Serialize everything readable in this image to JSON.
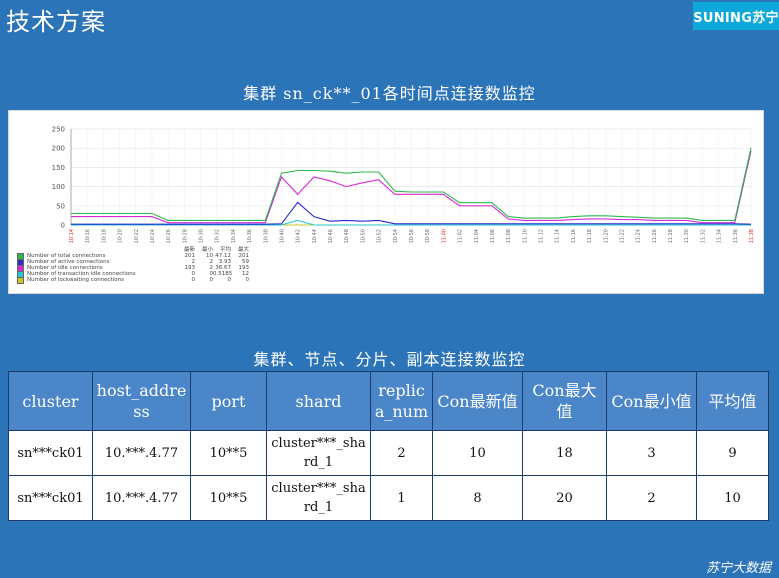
{
  "slide": {
    "title": "技术方案",
    "logo": "SUNING苏宁",
    "footer": "苏宁大数据"
  },
  "chart_section": {
    "title": "集群 sn_ck**_01各时间点连接数监控"
  },
  "table_section": {
    "title": "集群、节点、分片、副本连接数监控"
  },
  "chart_data": {
    "type": "line",
    "title": "",
    "xlabel": "",
    "ylabel": "",
    "ylim": [
      0,
      250
    ],
    "yticks": [
      0,
      50,
      100,
      150,
      200,
      250
    ],
    "x": [
      "10:14",
      "10:16",
      "10:18",
      "10:20",
      "10:22",
      "10:24",
      "10:26",
      "10:28",
      "10:30",
      "10:32",
      "10:34",
      "10:36",
      "10:38",
      "10:40",
      "10:42",
      "10:44",
      "10:46",
      "10:48",
      "10:50",
      "10:52",
      "10:54",
      "10:56",
      "10:58",
      "11:00",
      "11:02",
      "11:04",
      "11:06",
      "11:08",
      "11:10",
      "11:12",
      "11:14",
      "11:16",
      "11:18",
      "11:20",
      "11:22",
      "11:24",
      "11:26",
      "11:28",
      "11:30",
      "11:32",
      "11:34",
      "11:36",
      "11:38"
    ],
    "x_highlight": [
      "10:14",
      "11:00",
      "11:38"
    ],
    "grid": true,
    "legend_placement": "bottom-left",
    "legend_columns": [
      "最新",
      "最小",
      "平均",
      "最大"
    ],
    "series": [
      {
        "name": "Number of total connections",
        "color": "#2db84c",
        "values": [
          30,
          30,
          30,
          30,
          30,
          30,
          12,
          12,
          12,
          12,
          12,
          12,
          12,
          135,
          142,
          142,
          140,
          135,
          138,
          138,
          88,
          86,
          86,
          86,
          58,
          58,
          58,
          22,
          18,
          18,
          18,
          22,
          24,
          24,
          22,
          20,
          18,
          18,
          18,
          12,
          12,
          12,
          201
        ],
        "stats": [
          "201",
          "10",
          "47.12",
          "201"
        ]
      },
      {
        "name": "Number of active connections",
        "color": "#2a2ac8",
        "values": [
          2,
          2,
          2,
          2,
          2,
          2,
          2,
          2,
          2,
          2,
          2,
          2,
          2,
          3,
          59,
          22,
          10,
          12,
          10,
          12,
          3,
          3,
          3,
          3,
          3,
          3,
          3,
          3,
          3,
          3,
          3,
          3,
          3,
          3,
          3,
          3,
          3,
          3,
          3,
          3,
          3,
          3,
          2
        ],
        "stats": [
          "2",
          "2",
          "3.93",
          "59"
        ]
      },
      {
        "name": "Number of idle connections",
        "color": "#d62ad6",
        "values": [
          22,
          22,
          22,
          22,
          22,
          22,
          6,
          6,
          6,
          6,
          6,
          6,
          6,
          125,
          80,
          125,
          115,
          100,
          110,
          118,
          80,
          80,
          80,
          80,
          50,
          50,
          50,
          16,
          12,
          12,
          12,
          14,
          16,
          16,
          14,
          14,
          12,
          12,
          12,
          6,
          6,
          6,
          193
        ],
        "stats": [
          "193",
          "2",
          "36.67",
          "193"
        ]
      },
      {
        "name": "Number of transaction idle connections",
        "color": "#22c8d2",
        "values": [
          0,
          0,
          0,
          0,
          0,
          0,
          0,
          0,
          0,
          0,
          0,
          0,
          0,
          0,
          12,
          0,
          0,
          0,
          0,
          0,
          0,
          0,
          0,
          0,
          0,
          0,
          0,
          0,
          0,
          0,
          0,
          0,
          0,
          0,
          0,
          0,
          0,
          0,
          0,
          0,
          0,
          0,
          0
        ],
        "stats": [
          "0",
          "0",
          "0.5185",
          "12"
        ]
      },
      {
        "name": "Number of lockwaiting connections",
        "color": "#c8c820",
        "values": [
          0,
          0,
          0,
          0,
          0,
          0,
          0,
          0,
          0,
          0,
          0,
          0,
          0,
          0,
          0,
          0,
          0,
          0,
          0,
          0,
          0,
          0,
          0,
          0,
          0,
          0,
          0,
          0,
          0,
          0,
          0,
          0,
          0,
          0,
          0,
          0,
          0,
          0,
          0,
          0,
          0,
          0,
          0
        ],
        "stats": [
          "0",
          "0",
          "0",
          "0"
        ]
      }
    ]
  },
  "table": {
    "headers": [
      "cluster",
      "host_address",
      "port",
      "shard",
      "replica_num",
      "Con最新值",
      "Con最大值",
      "Con最小值",
      "平均值"
    ],
    "rows": [
      [
        "sn***ck01",
        "10.***.4.77",
        "10**5",
        "cluster***_shard_1",
        "2",
        "10",
        "18",
        "3",
        "9"
      ],
      [
        "sn***ck01",
        "10.***.4.77",
        "10**5",
        "cluster***_shard_1",
        "1",
        "8",
        "20",
        "2",
        "10"
      ]
    ]
  }
}
